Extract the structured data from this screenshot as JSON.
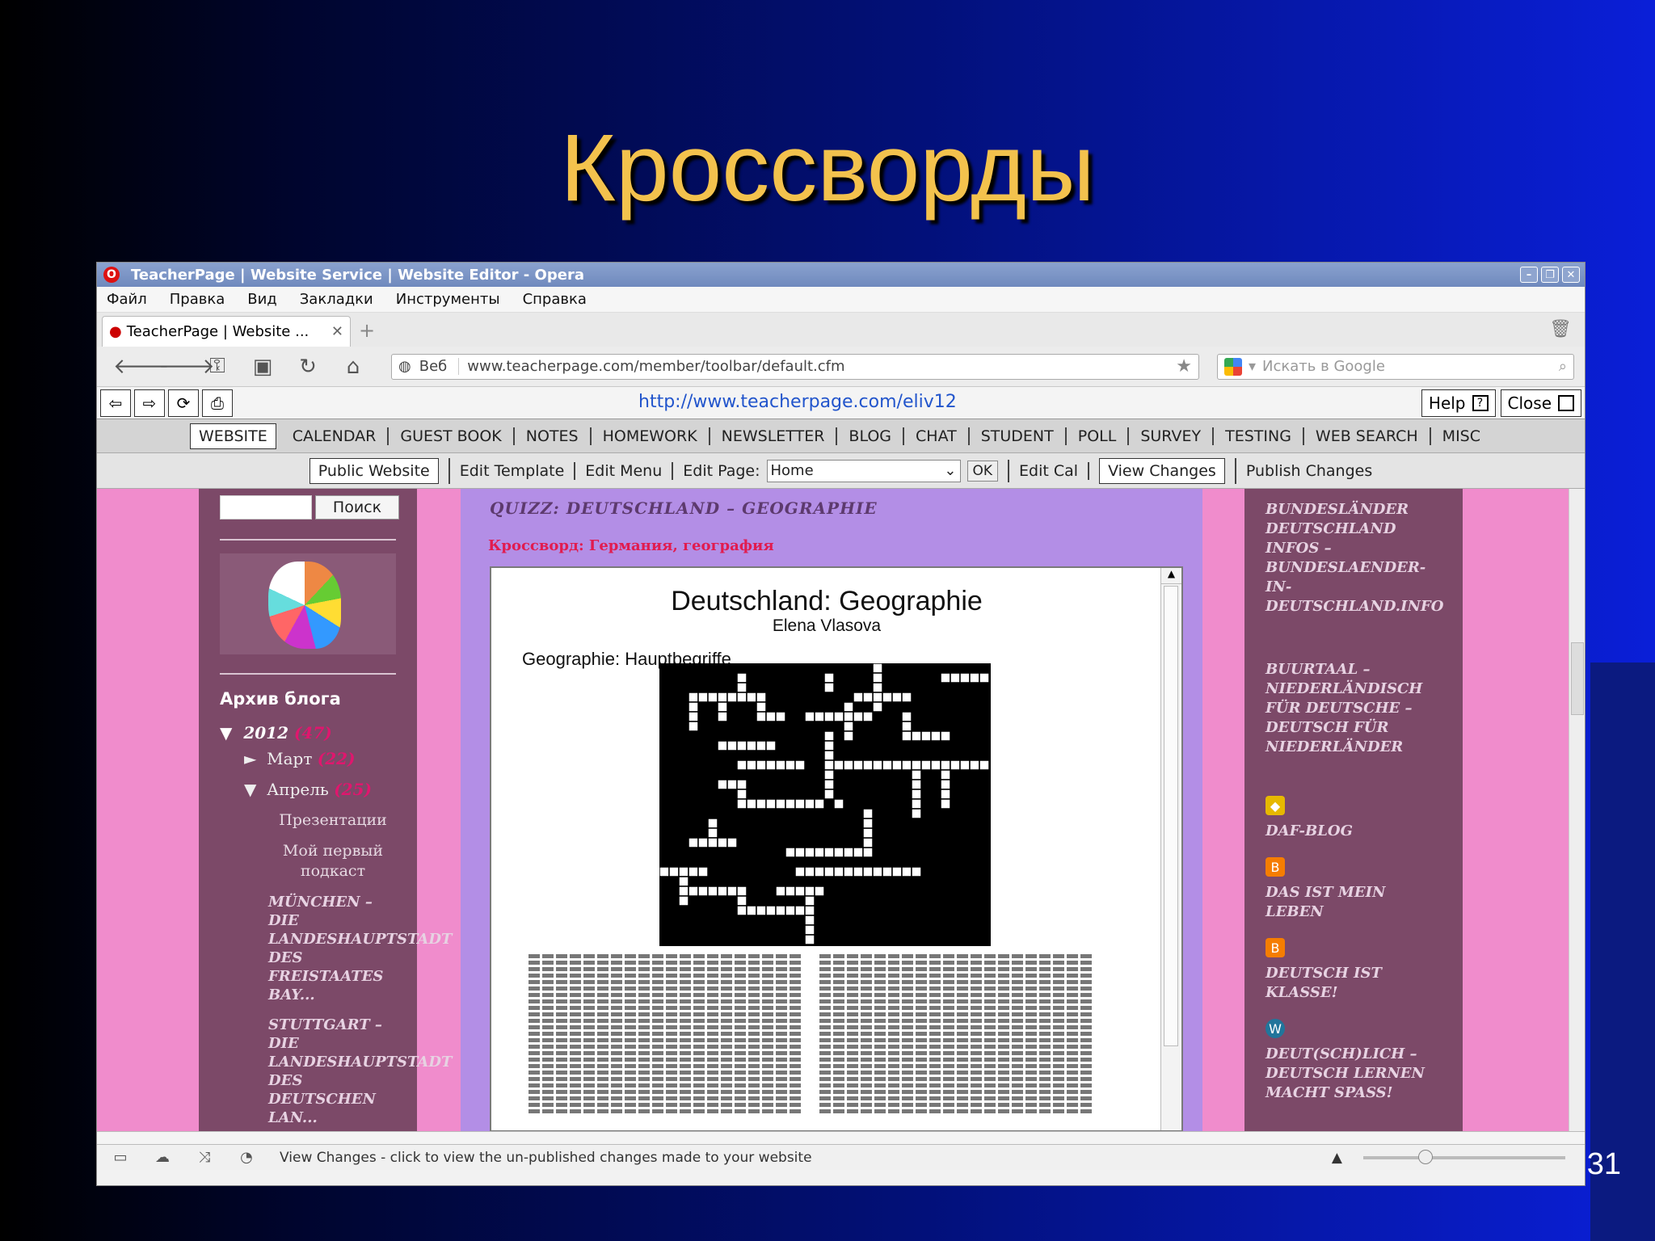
{
  "slide": {
    "title": "Кроссворды",
    "page_number": "31"
  },
  "window": {
    "title": "TeacherPage | Website Service | Website Editor - Opera"
  },
  "menubar": [
    "Файл",
    "Правка",
    "Вид",
    "Закладки",
    "Инструменты",
    "Справка"
  ],
  "tab": {
    "label": "TeacherPage | Website ...",
    "close": "✕",
    "new": "+"
  },
  "address": {
    "scope": "Веб",
    "url": "www.teacherpage.com/member/toolbar/default.cfm"
  },
  "search": {
    "placeholder": "Искать в Google"
  },
  "tp_toolbar": {
    "url": "http://www.teacherpage.com/eliv12",
    "help": "Help",
    "help_icon": "?",
    "close": "Close"
  },
  "nav_menu": [
    "WEBSITE",
    "CALENDAR",
    "GUEST BOOK",
    "NOTES",
    "HOMEWORK",
    "NEWSLETTER",
    "BLOG",
    "CHAT",
    "STUDENT",
    "POLL",
    "SURVEY",
    "TESTING",
    "WEB SEARCH",
    "MISC"
  ],
  "edit_bar": {
    "public_website": "Public Website",
    "edit_template": "Edit Template",
    "edit_menu": "Edit Menu",
    "edit_page_label": "Edit Page:",
    "edit_page_value": "Home",
    "ok": "OK",
    "edit_cal": "Edit Cal",
    "view_changes": "View Changes",
    "publish_changes": "Publish Changes"
  },
  "left_sidebar": {
    "search_button": "Поиск",
    "archive_heading": "Архив блога",
    "year": "2012",
    "year_count": "(47)",
    "months": [
      {
        "arrow": "►",
        "name": "Март",
        "count": "(22)"
      },
      {
        "arrow": "▼",
        "name": "Апрель",
        "count": "(25)"
      }
    ],
    "posts": [
      "Презентации",
      "Мой первый подкаст"
    ],
    "fancy_posts": [
      "MÜNCHEN – DIE LANDESHAUPTSTADT DES FREISTAATES BAY...",
      "STUTTGART – DIE LANDESHAUPTSTADT DES DEUTSCHEN LAN..."
    ]
  },
  "main": {
    "post_title": "QUIZZ: DEUTSCHLAND – GEOGRAPHIE",
    "subtitle": "Кроссворд: Германия, география",
    "doc_title": "Deutschland: Geographie",
    "doc_author": "Elena Vlasova",
    "doc_section": "Geographie: Hauptbegriffe"
  },
  "right_sidebar": {
    "links": [
      "BUNDESLÄNDER DEUTSCHLAND INFOS – BUNDESLAENDER-IN-DEUTSCHLAND.INFO",
      "BUURTAAL – NIEDERLÄNDISCH FÜR DEUTSCHE – DEUTSCH FÜR NIEDERLÄNDER",
      "DAF-BLOG",
      "DAS IST MEIN LEBEN",
      "DEUTSCH IST KLASSE!",
      "DEUT(SCH)LICH – DEUTSCH LERNEN MACHT SPASS!"
    ]
  },
  "statusbar": {
    "text": "View Changes - click to view the un-published changes made to your website"
  },
  "colors": {
    "slide_title": "#f3c24d",
    "page_pink": "#f08ccc",
    "sidebar": "#7c4968",
    "center": "#b38ee6",
    "accent_red": "#e11c4f"
  },
  "icons": [
    "opera-icon",
    "back-icon",
    "forward-icon",
    "key-icon",
    "save-icon",
    "reload-icon",
    "home-icon",
    "globe-icon",
    "star-icon",
    "google-icon",
    "search-icon",
    "trash-icon",
    "blogger-icon",
    "wordpress-icon"
  ]
}
